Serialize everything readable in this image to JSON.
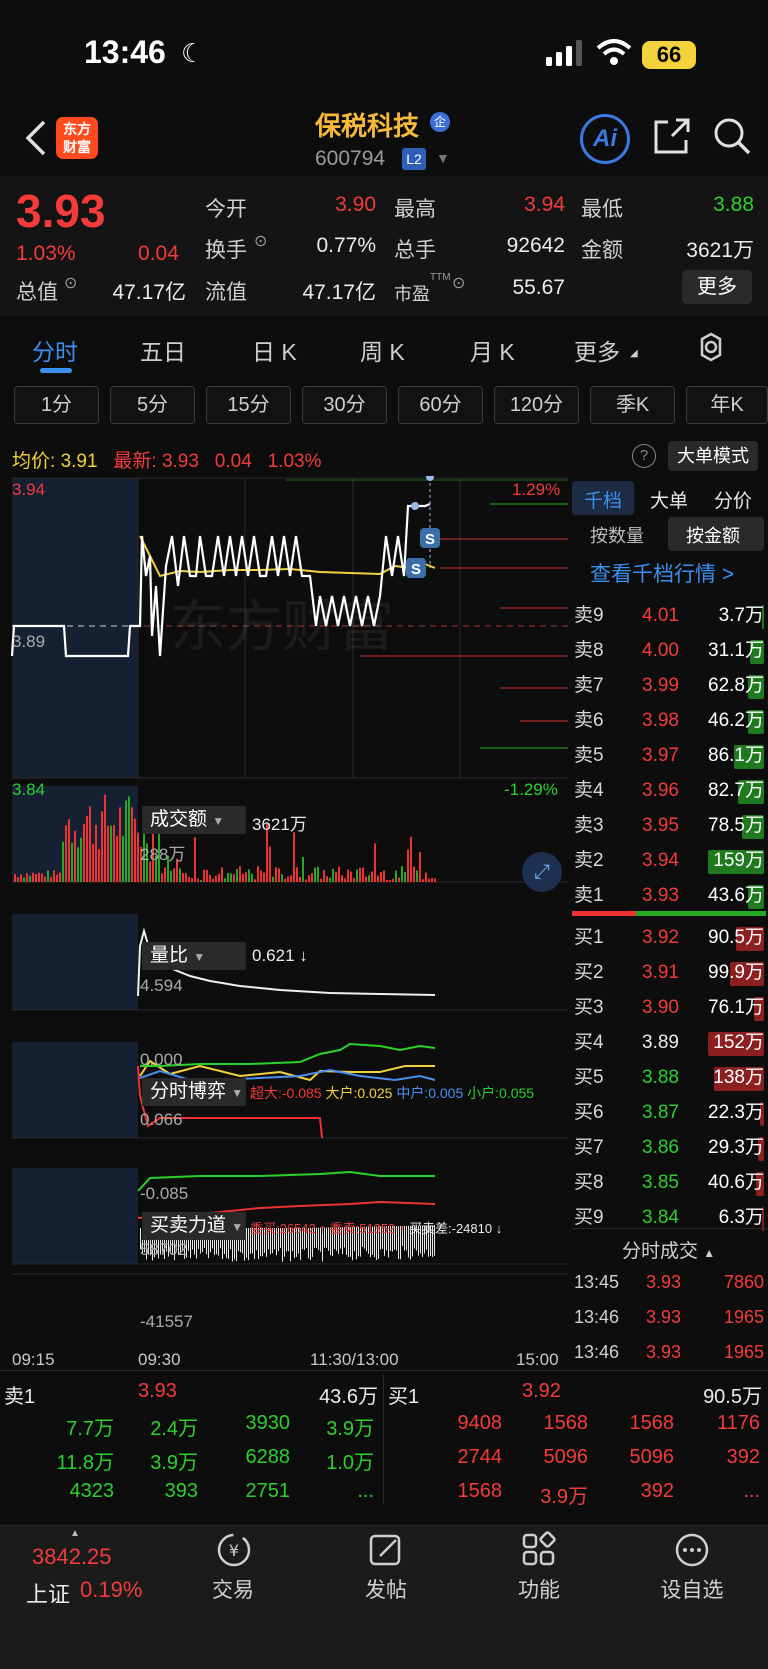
{
  "status": {
    "time": "13:46",
    "battery": "66"
  },
  "header": {
    "title": "保税科技",
    "ent_badge": "企",
    "code": "600794",
    "level": "L2",
    "logo_line1": "东方",
    "logo_line2": "财富",
    "ai": "Ai"
  },
  "quote": {
    "price": "3.93",
    "change_pct": "1.03%",
    "change": "0.04",
    "open_label": "今开",
    "open": "3.90",
    "high_label": "最高",
    "high": "3.94",
    "low_label": "最低",
    "low": "3.88",
    "turnover_label": "换手",
    "turnover": "0.77%",
    "volume_label": "总手",
    "volume": "92642",
    "amount_label": "金额",
    "amount": "3621万",
    "mktcap_label": "总值",
    "mktcap": "47.17亿",
    "float_label": "流值",
    "float": "47.17亿",
    "pe_label": "市盈",
    "pe_sup": "TTM",
    "pe": "55.67",
    "more": "更多"
  },
  "tabs": [
    "分时",
    "五日",
    "日 K",
    "周 K",
    "月 K",
    "更多"
  ],
  "periods": [
    "1分",
    "5分",
    "15分",
    "30分",
    "60分",
    "120分",
    "季K",
    "年K"
  ],
  "info_line": {
    "avg_label": "均价:",
    "avg": "3.91",
    "latest_label": "最新:",
    "latest": "3.93",
    "chg": "0.04",
    "pct": "1.03%",
    "help": "?",
    "big_order_mode": "大单模式"
  },
  "chart": {
    "y_high": "3.94",
    "y_mid": "3.89",
    "y_low": "3.84",
    "pct_high": "1.29%",
    "pct_low": "-1.29%",
    "watermark": "东方财富",
    "amount_label": "成交额",
    "amount_value": "3621万",
    "amount_max": "288万",
    "ratio_label": "量比",
    "ratio_value": "0.621 ↓",
    "ratio_max": "4.594",
    "ratio_min": "0.000",
    "game_label": "分时博弈",
    "game_super": "超大:-0.085",
    "game_big": "大户:0.025",
    "game_mid": "中户:0.005",
    "game_small": "小户:0.055",
    "game_max": "0.066",
    "game_min": "-0.085",
    "force_label": "买卖力道",
    "force_buy": "委买:26542 ↑",
    "force_sell": "委卖:51352 ↑",
    "force_diff": "买卖差:-24810 ↓",
    "force_max": "58702",
    "force_min": "-41557",
    "times": [
      "09:15",
      "09:30",
      "11:30/13:00",
      "15:00"
    ],
    "marker": "S"
  },
  "right_panel": {
    "tabs": [
      "千档",
      "大单",
      "分价"
    ],
    "amount_tabs": [
      "按数量",
      "按金额"
    ],
    "depth_link": "查看千档行情 >",
    "asks": [
      {
        "label": "卖9",
        "price": "4.01",
        "vol": "3.7万"
      },
      {
        "label": "卖8",
        "price": "4.00",
        "vol": "31.1万"
      },
      {
        "label": "卖7",
        "price": "3.99",
        "vol": "62.8万"
      },
      {
        "label": "卖6",
        "price": "3.98",
        "vol": "46.2万"
      },
      {
        "label": "卖5",
        "price": "3.97",
        "vol": "86.1万"
      },
      {
        "label": "卖4",
        "price": "3.96",
        "vol": "82.7万"
      },
      {
        "label": "卖3",
        "price": "3.95",
        "vol": "78.5万"
      },
      {
        "label": "卖2",
        "price": "3.94",
        "vol": "159万"
      },
      {
        "label": "卖1",
        "price": "3.93",
        "vol": "43.6万"
      }
    ],
    "bids": [
      {
        "label": "买1",
        "price": "3.92",
        "vol": "90.5万"
      },
      {
        "label": "买2",
        "price": "3.91",
        "vol": "99.9万"
      },
      {
        "label": "买3",
        "price": "3.90",
        "vol": "76.1万"
      },
      {
        "label": "买4",
        "price": "3.89",
        "vol": "152万"
      },
      {
        "label": "买5",
        "price": "3.88",
        "vol": "138万"
      },
      {
        "label": "买6",
        "price": "3.87",
        "vol": "22.3万"
      },
      {
        "label": "买7",
        "price": "3.86",
        "vol": "29.3万"
      },
      {
        "label": "买8",
        "price": "3.85",
        "vol": "40.6万"
      },
      {
        "label": "买9",
        "price": "3.84",
        "vol": "6.3万"
      }
    ],
    "trades_header": "分时成交",
    "trades": [
      {
        "time": "13:45",
        "price": "3.93",
        "vol": "7860"
      },
      {
        "time": "13:46",
        "price": "3.93",
        "vol": "1965"
      },
      {
        "time": "13:46",
        "price": "3.93",
        "vol": "1965"
      }
    ]
  },
  "bottom": {
    "sell_label": "卖1",
    "sell_price": "3.93",
    "sell_vol": "43.6万",
    "buy_label": "买1",
    "buy_price": "3.92",
    "buy_vol": "90.5万",
    "sell_rows": [
      [
        "7.7万",
        "2.4万",
        "3930",
        "3.9万"
      ],
      [
        "11.8万",
        "3.9万",
        "6288",
        "1.0万"
      ],
      [
        "4323",
        "393",
        "2751",
        "..."
      ]
    ],
    "buy_rows": [
      [
        "9408",
        "1568",
        "1568",
        "1176"
      ],
      [
        "2744",
        "5096",
        "5096",
        "392"
      ],
      [
        "1568",
        "3.9万",
        "392",
        "..."
      ]
    ]
  },
  "nav": {
    "index_value": "3842.25",
    "index_name": "上证",
    "index_pct": "0.19%",
    "items": [
      "交易",
      "发帖",
      "功能",
      "设自选"
    ]
  }
}
